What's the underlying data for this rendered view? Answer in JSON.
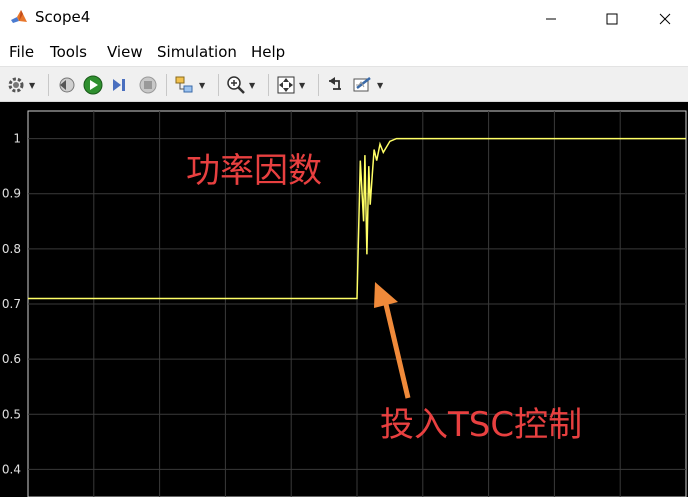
{
  "window": {
    "title": "Scope4"
  },
  "menu": [
    "File",
    "Tools",
    "View",
    "Simulation",
    "Help"
  ],
  "toolbar": {
    "buttons": [
      "settings-icon",
      "step-back-icon",
      "run-icon",
      "step-forward-icon",
      "stop-icon",
      "highlight-icon",
      "zoom-in-icon",
      "autoscale-icon",
      "restore-icon",
      "measurement-icon"
    ]
  },
  "chart_data": {
    "type": "line",
    "ylim": [
      0.35,
      1.05
    ],
    "yticks": [
      "1",
      "0.9",
      "0.8",
      "0.7",
      "0.6",
      "0.5",
      "0.4"
    ],
    "grid": true,
    "line_color": "#ffff66",
    "background": "#000000",
    "series": [
      {
        "x": [
          0,
          0.5,
          0.505,
          0.51,
          0.512,
          0.515,
          0.518,
          0.52,
          0.523,
          0.526,
          0.53,
          0.535,
          0.54,
          0.55,
          0.56,
          0.58,
          1.0
        ],
        "values": [
          0.71,
          0.71,
          0.96,
          0.85,
          0.97,
          0.79,
          0.95,
          0.88,
          0.93,
          0.98,
          0.96,
          0.99,
          0.975,
          0.995,
          1.0,
          1.0,
          1.0
        ]
      }
    ],
    "annotations": [
      {
        "text": "功率因数",
        "color": "#e84040"
      },
      {
        "text": "投入TSC控制",
        "color": "#e84040"
      }
    ]
  }
}
